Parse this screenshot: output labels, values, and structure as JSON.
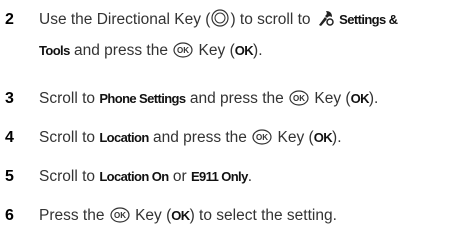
{
  "steps": [
    {
      "number": "2",
      "line1_prefix": "Use the Directional Key (",
      "line1_mid": ") to scroll to ",
      "settings_label": "Settings &",
      "tools_label": "Tools",
      "line2_mid": " and press the ",
      "line2_key_prefix": " Key (",
      "ok_label": "OK",
      "line2_suffix": ")."
    },
    {
      "number": "3",
      "prefix": "Scroll to ",
      "target": "Phone Settings",
      "mid": " and press the ",
      "key_prefix": " Key (",
      "ok_label": "OK",
      "suffix": ")."
    },
    {
      "number": "4",
      "prefix": "Scroll to ",
      "target": "Location",
      "mid": " and press the ",
      "key_prefix": " Key (",
      "ok_label": "OK",
      "suffix": ")."
    },
    {
      "number": "5",
      "prefix": "Scroll to ",
      "target": "Location On",
      "mid": " or ",
      "target2": "E911 Only",
      "suffix": "."
    },
    {
      "number": "6",
      "prefix": "Press the ",
      "key_prefix": " Key (",
      "ok_label": "OK",
      "suffix": ") to select the setting."
    }
  ],
  "icons": {
    "directional_key": "directional-key-icon",
    "ok_key": "ok-key-icon",
    "settings_tools": "settings-tools-icon"
  }
}
